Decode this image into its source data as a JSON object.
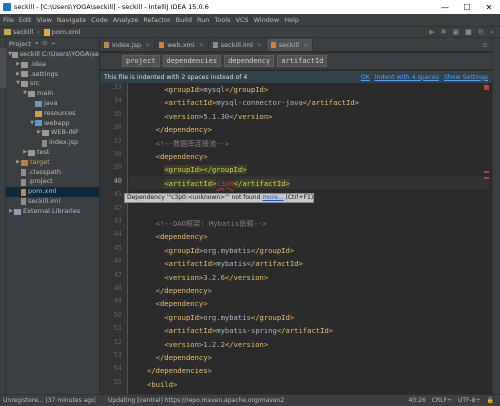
{
  "window": {
    "title": "seckill - [C:\\Users\\YOGA\\seckill] - seckill - IntelliJ IDEA 15.0.6",
    "min": "—",
    "max": "☐",
    "close": "✕"
  },
  "menu": [
    "File",
    "Edit",
    "View",
    "Navigate",
    "Code",
    "Analyze",
    "Refactor",
    "Build",
    "Run",
    "Tools",
    "VCS",
    "Window",
    "Help"
  ],
  "breadcrumbs": [
    "seckill",
    "pom.xml"
  ],
  "project": {
    "header": "Project",
    "tree": [
      {
        "label": "seckill  C:\\Users\\YOGA\\se",
        "icon": "folder",
        "depth": 0,
        "arrow": "▼"
      },
      {
        "label": ".idea",
        "icon": "folder",
        "depth": 1,
        "arrow": "▶"
      },
      {
        "label": ".settings",
        "icon": "folder",
        "depth": 1,
        "arrow": "▶"
      },
      {
        "label": "src",
        "icon": "folder",
        "depth": 1,
        "arrow": "▼"
      },
      {
        "label": "main",
        "icon": "folder",
        "depth": 2,
        "arrow": "▼"
      },
      {
        "label": "java",
        "icon": "src",
        "depth": 3,
        "arrow": ""
      },
      {
        "label": "resources",
        "icon": "res",
        "depth": 3,
        "arrow": ""
      },
      {
        "label": "webapp",
        "icon": "web",
        "depth": 3,
        "arrow": "▼"
      },
      {
        "label": "WEB-INF",
        "icon": "folder",
        "depth": 4,
        "arrow": "▶"
      },
      {
        "label": "index.jsp",
        "icon": "file",
        "depth": 4,
        "arrow": ""
      },
      {
        "label": "test",
        "icon": "folder",
        "depth": 2,
        "arrow": "▶"
      },
      {
        "label": "target",
        "icon": "target",
        "depth": 1,
        "arrow": "▶"
      },
      {
        "label": ".classpath",
        "icon": "file",
        "depth": 1,
        "arrow": ""
      },
      {
        "label": ".project",
        "icon": "file",
        "depth": 1,
        "arrow": ""
      },
      {
        "label": "pom.xml",
        "icon": "xml",
        "depth": 1,
        "arrow": ""
      },
      {
        "label": "seckill.iml",
        "icon": "file",
        "depth": 1,
        "arrow": ""
      },
      {
        "label": "External Libraries",
        "icon": "lib",
        "depth": 0,
        "arrow": "▶"
      }
    ]
  },
  "tabs": [
    "index.jsp",
    "web.xml",
    "seckill.iml",
    "seckill"
  ],
  "xml_breadcrumbs": [
    "project",
    "dependencies",
    "dependency",
    "artifactId"
  ],
  "banner": {
    "text": "This file is indented with 2 spaces instead of 4",
    "links": [
      "OK",
      "Indent with 4 spaces",
      "Show Settings"
    ]
  },
  "tooltip": {
    "text": "Dependency '\"c3p0:<unknown>\"' not found ",
    "more": "more...",
    "shortcut": " (Ctrl+F1)"
  },
  "line_numbers": [
    "33",
    "34",
    "35",
    "36",
    "37",
    "38",
    "39",
    "40",
    "41",
    "42",
    "43",
    "44",
    "45",
    "46",
    "47",
    "48",
    "49",
    "50",
    "51",
    "52",
    "53",
    "54",
    "55"
  ],
  "code": [
    {
      "i": "    ",
      "o": "<groupId>",
      "t": "mysql",
      "c": "</groupId>"
    },
    {
      "i": "    ",
      "o": "<artifactId>",
      "t": "mysql-connector-java",
      "c": "</artifactId>"
    },
    {
      "i": "    ",
      "o": "<version>",
      "t": "5.1.30",
      "c": "</version>"
    },
    {
      "i": "  ",
      "o": "</dependency>",
      "t": "",
      "c": ""
    },
    {
      "i": "  ",
      "cm": "<!--数据库连接池-->"
    },
    {
      "i": "  ",
      "o": "<dependency>",
      "t": "",
      "c": ""
    },
    {
      "i": "    ",
      "o": "<groupId>",
      "t": "",
      "c": "</groupId>",
      "hl": true
    },
    {
      "i": "    ",
      "o": "<artifactId>",
      "err": "c3p0",
      "c": "</artifactId>",
      "hl": true
    },
    {
      "i": "",
      "o": "",
      "t": "",
      "c": ""
    },
    {
      "i": "",
      "o": "",
      "t": "",
      "c": ""
    },
    {
      "i": "  ",
      "cm": "<!--DAO框架: Mybatis依赖-->"
    },
    {
      "i": "  ",
      "o": "<dependency>",
      "t": "",
      "c": ""
    },
    {
      "i": "    ",
      "o": "<groupId>",
      "t": "org.mybatis",
      "c": "</groupId>"
    },
    {
      "i": "    ",
      "o": "<artifactId>",
      "t": "mybatis",
      "c": "</artifactId>"
    },
    {
      "i": "    ",
      "o": "<version>",
      "t": "3.2.6",
      "c": "</version>"
    },
    {
      "i": "  ",
      "o": "</dependency>",
      "t": "",
      "c": ""
    },
    {
      "i": "  ",
      "o": "<dependency>",
      "t": "",
      "c": ""
    },
    {
      "i": "    ",
      "o": "<groupId>",
      "t": "org.mybatis",
      "c": "</groupId>"
    },
    {
      "i": "    ",
      "o": "<artifactId>",
      "t": "mybatis-spring",
      "c": "</artifactId>"
    },
    {
      "i": "    ",
      "o": "<version>",
      "t": "1.2.2",
      "c": "</version>"
    },
    {
      "i": "  ",
      "o": "</dependency>",
      "t": "",
      "c": ""
    },
    {
      "i": "",
      "o": "</dependencies>",
      "t": "",
      "c": ""
    },
    {
      "i": "",
      "o": "<build>",
      "t": "",
      "c": ""
    }
  ],
  "status": {
    "left": "Unregistere... (37 minutes ago)",
    "progress": "Updating [central] https://repo.maven.apache.org/maven2",
    "position": "40:26",
    "line_sep": "CRLF÷",
    "encoding": "UTF-8÷"
  }
}
